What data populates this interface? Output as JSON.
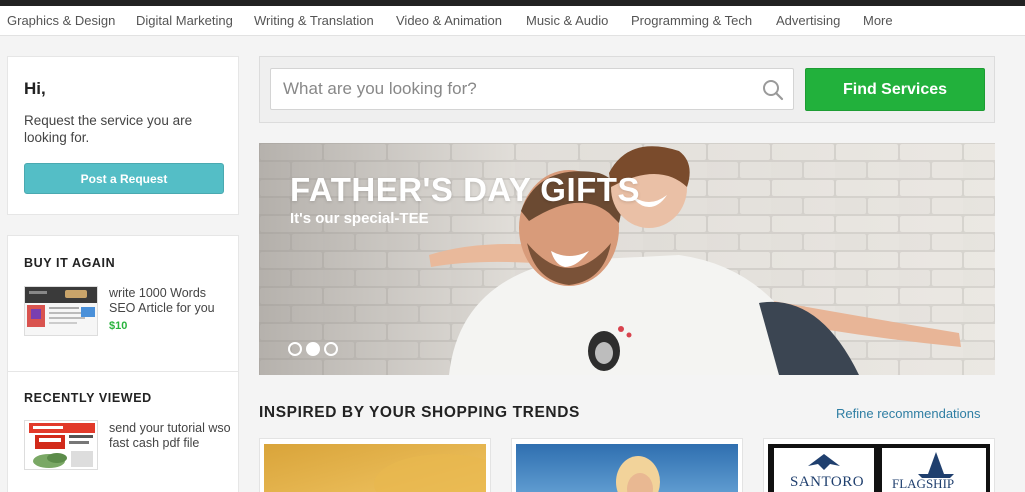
{
  "nav": {
    "categories": [
      "Graphics & Design",
      "Digital Marketing",
      "Writing & Translation",
      "Video & Animation",
      "Music & Audio",
      "Programming & Tech",
      "Advertising",
      "More"
    ]
  },
  "greeting": {
    "title": "Hi,",
    "text": "Request the service you are looking for.",
    "button_label": "Post a Request"
  },
  "buy_again": {
    "heading": "BUY IT AGAIN",
    "item": {
      "title": "write 1000 Words SEO Article for you",
      "price": "$10"
    }
  },
  "recently_viewed": {
    "heading": "RECENTLY VIEWED",
    "item": {
      "title": "send your tutorial wso fast cash pdf file"
    }
  },
  "search": {
    "placeholder": "What are you looking for?",
    "button_label": "Find Services"
  },
  "hero": {
    "title": "FATHER'S DAY GIFTS",
    "subtitle": "It's our special-TEE",
    "slide_count": 3,
    "active_slide": 2
  },
  "trends": {
    "heading": "INSPIRED BY YOUR SHOPPING TRENDS",
    "refine_label": "Refine recommendations",
    "gig_logo_texts": [
      "SANTORO",
      "FLAGSHIP"
    ]
  },
  "colors": {
    "find_button": "#22b13c",
    "request_button": "#54bec6",
    "price": "#2ab33e",
    "link": "#2f7ea3"
  }
}
